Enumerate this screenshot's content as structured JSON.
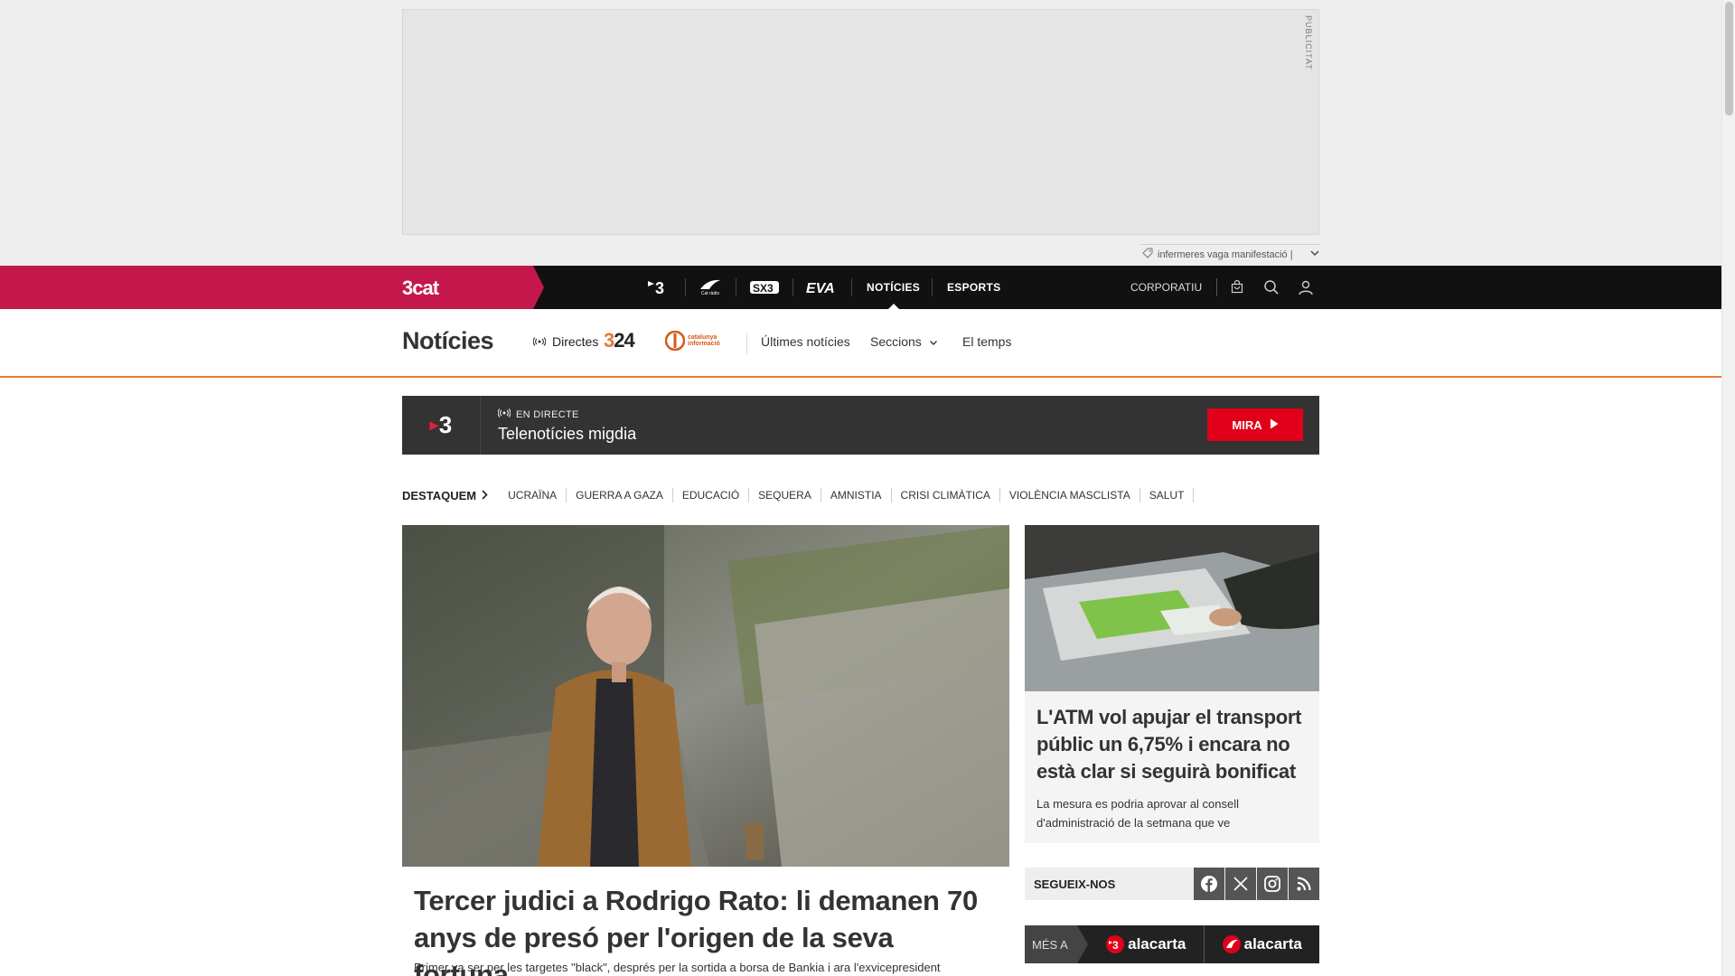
{
  "ad": {
    "label": "PUBLICITAT",
    "trending_text": "infermeres vaga manifestació |"
  },
  "topnav": {
    "brand": "3cat",
    "channels": [
      "tv3-logo",
      "catradio-logo",
      "sx3-logo",
      "eva-logo"
    ],
    "catradio_text": "Cat ràdio",
    "links": {
      "noticies": "NOTÍCIES",
      "esports": "ESPORTS"
    },
    "corporatiu": "CORPORATIU"
  },
  "subnav": {
    "title": "Notícies",
    "directes": "Directes",
    "logo_324": "324",
    "logo_cat": [
      "catalunya",
      "informació"
    ],
    "ultimes": "Últimes notícies",
    "seccions": "Seccions",
    "temps": "El temps"
  },
  "live": {
    "channel": "3",
    "tag": "EN DIRECTE",
    "program": "Telenotícies migdia",
    "button": "MIRA"
  },
  "highlights": {
    "label": "DESTAQUEM",
    "items": [
      "UCRAÏNA",
      "GUERRA A GAZA",
      "EDUCACIÓ",
      "SEQUERA",
      "AMNISTIA",
      "CRISI CLIMÀTICA",
      "VIOLÈNCIA MASCLISTA",
      "SALUT"
    ]
  },
  "lead": {
    "title": "Tercer judici a Rodrigo Rato: li demanen 70 anys de presó per l'origen de la seva fortuna",
    "summary": "Primer va ser per les targetes \"black\", després per la sortida a borsa de Bankia i ara l'exvicepresident"
  },
  "side": {
    "title": "L'ATM vol apujar el transport públic un 6,75% i encara no està clar si seguirà bonificat",
    "summary": "La mesura es podria aprovar al consell d'administració de la setmana que ve"
  },
  "follow": {
    "label": "SEGUEIX-NOS",
    "networks": [
      "facebook-icon",
      "x-icon",
      "instagram-icon",
      "rss-icon"
    ]
  },
  "alacarta": {
    "more": "MÉS A",
    "brand1": "alacarta",
    "brand2": "alacarta"
  },
  "colors": {
    "brand": "#c4184c",
    "topnav_bg": "#111111",
    "accent_orange": "#e8773b",
    "live_button": "#e1001a"
  }
}
